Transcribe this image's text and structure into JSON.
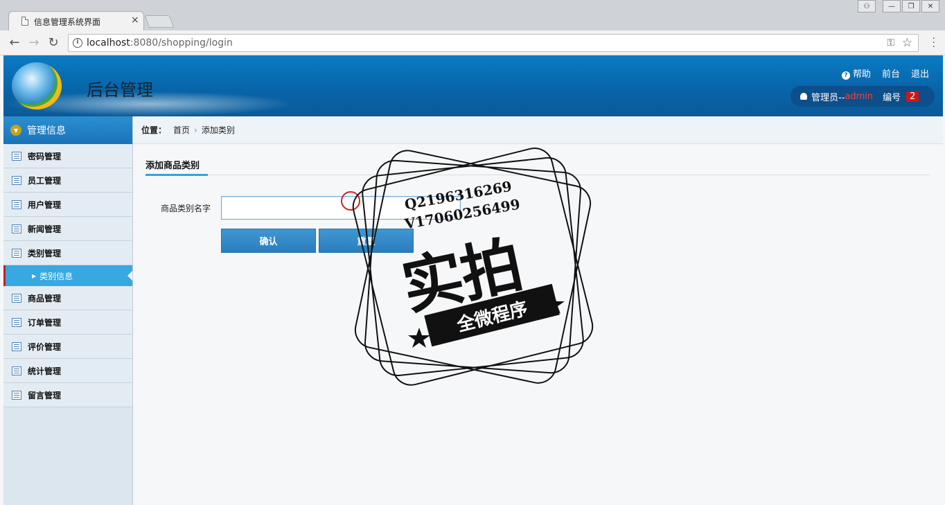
{
  "browser": {
    "tab_title": "信息管理系统界面",
    "tab_close": "×",
    "url_host": "localhost",
    "url_rest": ":8080/shopping/login",
    "back": "←",
    "forward": "→",
    "reload": "↻",
    "key": "⚿",
    "star": "☆",
    "window_buttons": [
      "⚇",
      "—",
      "❐",
      "✕"
    ]
  },
  "header": {
    "title": "后台管理",
    "nav": {
      "help": "帮助",
      "front": "前台",
      "logout": "退出"
    },
    "user_prefix": "管理员--",
    "username": "admin",
    "id_label": "编号",
    "id_value": "2"
  },
  "sidebar": {
    "heading": "管理信息",
    "items": [
      {
        "label": "密码管理"
      },
      {
        "label": "员工管理"
      },
      {
        "label": "用户管理"
      },
      {
        "label": "新闻管理"
      },
      {
        "label": "类别管理"
      }
    ],
    "active_sub": "类别信息",
    "items_after": [
      {
        "label": "商品管理"
      },
      {
        "label": "订单管理"
      },
      {
        "label": "评价管理"
      },
      {
        "label": "统计管理"
      },
      {
        "label": "留言管理"
      }
    ]
  },
  "breadcrumb": {
    "label": "位置：",
    "home": "首页",
    "sep": "›",
    "current": "添加类别"
  },
  "form": {
    "tab": "添加商品类别",
    "field_label": "商品类别名字",
    "field_value": "",
    "confirm": "确认",
    "reset": "重置"
  },
  "watermark": {
    "line1": "Q2196316269",
    "line2": "V17060256499",
    "big": "实拍",
    "banner": "全微程序"
  }
}
